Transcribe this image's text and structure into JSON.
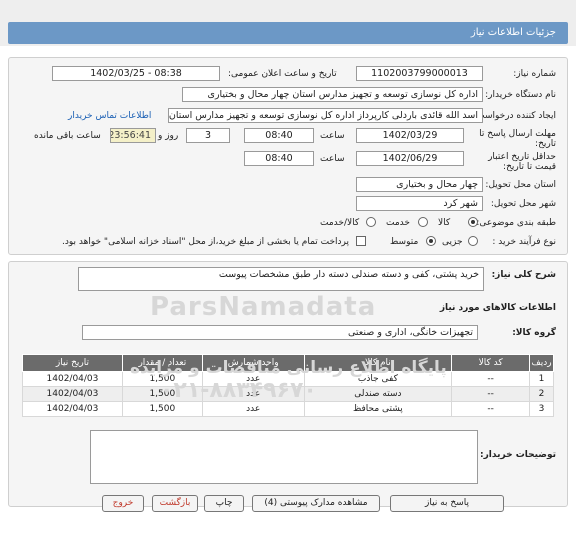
{
  "title": "جزئیات اطلاعات نیاز",
  "fields": {
    "need_number_label": "شماره نیاز:",
    "need_number": "1102003799000013",
    "announce_label": "تاریخ و ساعت اعلان عمومی:",
    "announce_value": "1402/03/25 - 08:38",
    "buyer_org_label": "نام دستگاه خریدار:",
    "buyer_org": "اداره کل نوسازی  توسعه و تجهیز مدارس استان چهار محال و بختیاری",
    "creator_label": "ایجاد کننده درخواست:",
    "creator": "اسد الله قائدی باردلی کارپرداز اداره کل نوسازی  توسعه و تجهیز مدارس استان",
    "contact_link": "اطلاعات تماس خریدار",
    "deadline_label": "مهلت ارسال پاسخ تا",
    "deadline_label2": "تاریخ:",
    "deadline_date": "1402/03/29",
    "time_label": "ساعت",
    "deadline_time": "08:40",
    "days_value": "3",
    "days_label": "روز و",
    "remaining_value": "23:56:41",
    "remaining_label": "ساعت باقی مانده",
    "validity_label": "حداقل تاریخ اعتبار",
    "validity_label2": "قیمت تا تاریخ:",
    "validity_date": "1402/06/29",
    "validity_time_label": "ساعت",
    "validity_time": "08:40",
    "province_label": "استان محل تحویل:",
    "province": "چهار محال و بختیاری",
    "city_label": "شهر محل تحویل:",
    "city": "شهر کرد",
    "category_label": "طبقه بندی موضوعی:",
    "category_options": [
      "کالا",
      "خدمت",
      "کالا/خدمت"
    ],
    "process_label": "نوع فرآیند خرید :",
    "process_options": [
      "جزیی",
      "متوسط"
    ],
    "payment_note": "پرداخت تمام یا بخشی از مبلغ خرید،از محل \"اسناد خزانه اسلامی\" خواهد بود."
  },
  "summary_label": "شرح کلی نیاز:",
  "summary": "خرید پشتی، کفی و دسته صندلی دسته دار طبق مشخصات پیوست",
  "goods_heading": "اطلاعات کالاهای مورد نیاز",
  "group_label": "گروه کالا:",
  "group_value": "تجهیزات خانگی، اداری و صنعتی",
  "table": {
    "headers": [
      "ردیف",
      "کد کالا",
      "نام کالا",
      "واحد شمارش",
      "تعداد / مقدار",
      "تاریخ نیاز"
    ],
    "rows": [
      [
        "1",
        "--",
        "کفی جاذب",
        "عدد",
        "1,500",
        "1402/04/03"
      ],
      [
        "2",
        "--",
        "دسته صندلی",
        "عدد",
        "1,500",
        "1402/04/03"
      ],
      [
        "3",
        "--",
        "پشتی محافظ",
        "عدد",
        "1,500",
        "1402/04/03"
      ]
    ]
  },
  "buyer_notes_label": "توضیحات خریدار:",
  "buttons": {
    "reply": "پاسخ به نیاز",
    "attachments": "مشاهده مدارک پیوستی (4)",
    "print": "چاپ",
    "back": "بازگشت",
    "exit": "خروج"
  },
  "watermark": {
    "brand": "ParsNamadata",
    "line1": "پایگاه اطلاع رسانی مناقصات و مزایده",
    "phone": "۰۲۱-۸۸۳۴۹۶۷۰"
  }
}
